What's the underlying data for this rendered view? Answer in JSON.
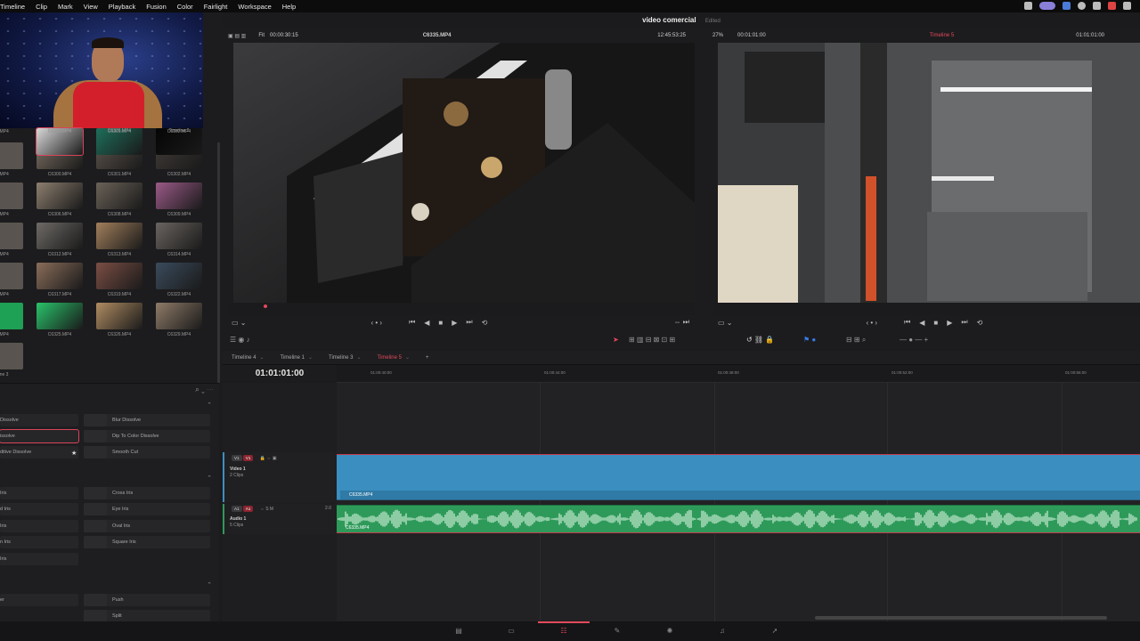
{
  "menu": [
    "Timeline",
    "Clip",
    "Mark",
    "View",
    "Playback",
    "Fusion",
    "Color",
    "Fairlight",
    "Workspace",
    "Help"
  ],
  "project": {
    "title": "video comercial",
    "status": "Edited"
  },
  "source_viewer": {
    "fit": "Fit",
    "duration": "00:00:30:15",
    "clip": "C6335.MP4",
    "timecode": "12:45:53:25"
  },
  "timeline_viewer": {
    "zoom": "27%",
    "position": "00:01:01:00",
    "timeline": "Timeline 5",
    "timecode": "01:01:01:00"
  },
  "media_pool": [
    {
      "name": "C6300.MP4"
    },
    {
      "name": "C6301.MP4"
    },
    {
      "name": "C6302.MP4"
    },
    {
      "name": "C6306.MP4"
    },
    {
      "name": "C6308.MP4"
    },
    {
      "name": "C6309.MP4"
    },
    {
      "name": "C6312.MP4"
    },
    {
      "name": "C6313.MP4"
    },
    {
      "name": "C6314.MP4"
    },
    {
      "name": "C6317.MP4"
    },
    {
      "name": "C6319.MP4"
    },
    {
      "name": "C6322.MP4"
    },
    {
      "name": "C6325.MP4"
    },
    {
      "name": "C6326.MP4"
    },
    {
      "name": "C6329.MP4"
    },
    {
      "name": "C6335.MP4"
    },
    {
      "name": "C6336.MP4"
    },
    {
      "name": "Timeline 2"
    }
  ],
  "media_left_labels": [
    ".MP4",
    ".MP4",
    ".MP4",
    ".MP4",
    ".MP4",
    ".MP4",
    "ine 3"
  ],
  "transitions": {
    "dissolve_left": [
      "Dissolve",
      "issolve",
      "ditive Dissolve"
    ],
    "dissolve_right": [
      "Blur Dissolve",
      "Dip To Color Dissolve",
      "Smooth Cut"
    ],
    "iris_left": [
      "Iris",
      "d Iris",
      "Iris",
      "n Iris",
      "Iris"
    ],
    "iris_right": [
      "Cross Iris",
      "Eye Iris",
      "Oval Iris",
      "Square Iris"
    ],
    "motion_left": [
      "er"
    ],
    "motion_right": [
      "Push",
      "Split"
    ]
  },
  "timeline_tabs": [
    "Timeline 4",
    "Timeline 1",
    "Timeline 3",
    "Timeline 5"
  ],
  "timeline": {
    "timecode": "01:01:01:00",
    "ruler": [
      "01:00:40:00",
      "01:00:44:00",
      "01:00:48:00",
      "01:00:52:00",
      "01:00:56:00"
    ],
    "video_track": {
      "badge1": "V1",
      "badge2": "V1",
      "name": "Video 1",
      "clips": "2 Clips",
      "clip": "C6335.MP4"
    },
    "audio_track": {
      "badge1": "A1",
      "badge2": "A1",
      "name": "Audio 1",
      "clips": "5 Clips",
      "clip": "C6335.MP4",
      "level": "2.0"
    }
  },
  "colors": {
    "accent": "#e3495b",
    "video_clip": "#3a8fc0",
    "audio_clip": "#2e9a5a"
  }
}
